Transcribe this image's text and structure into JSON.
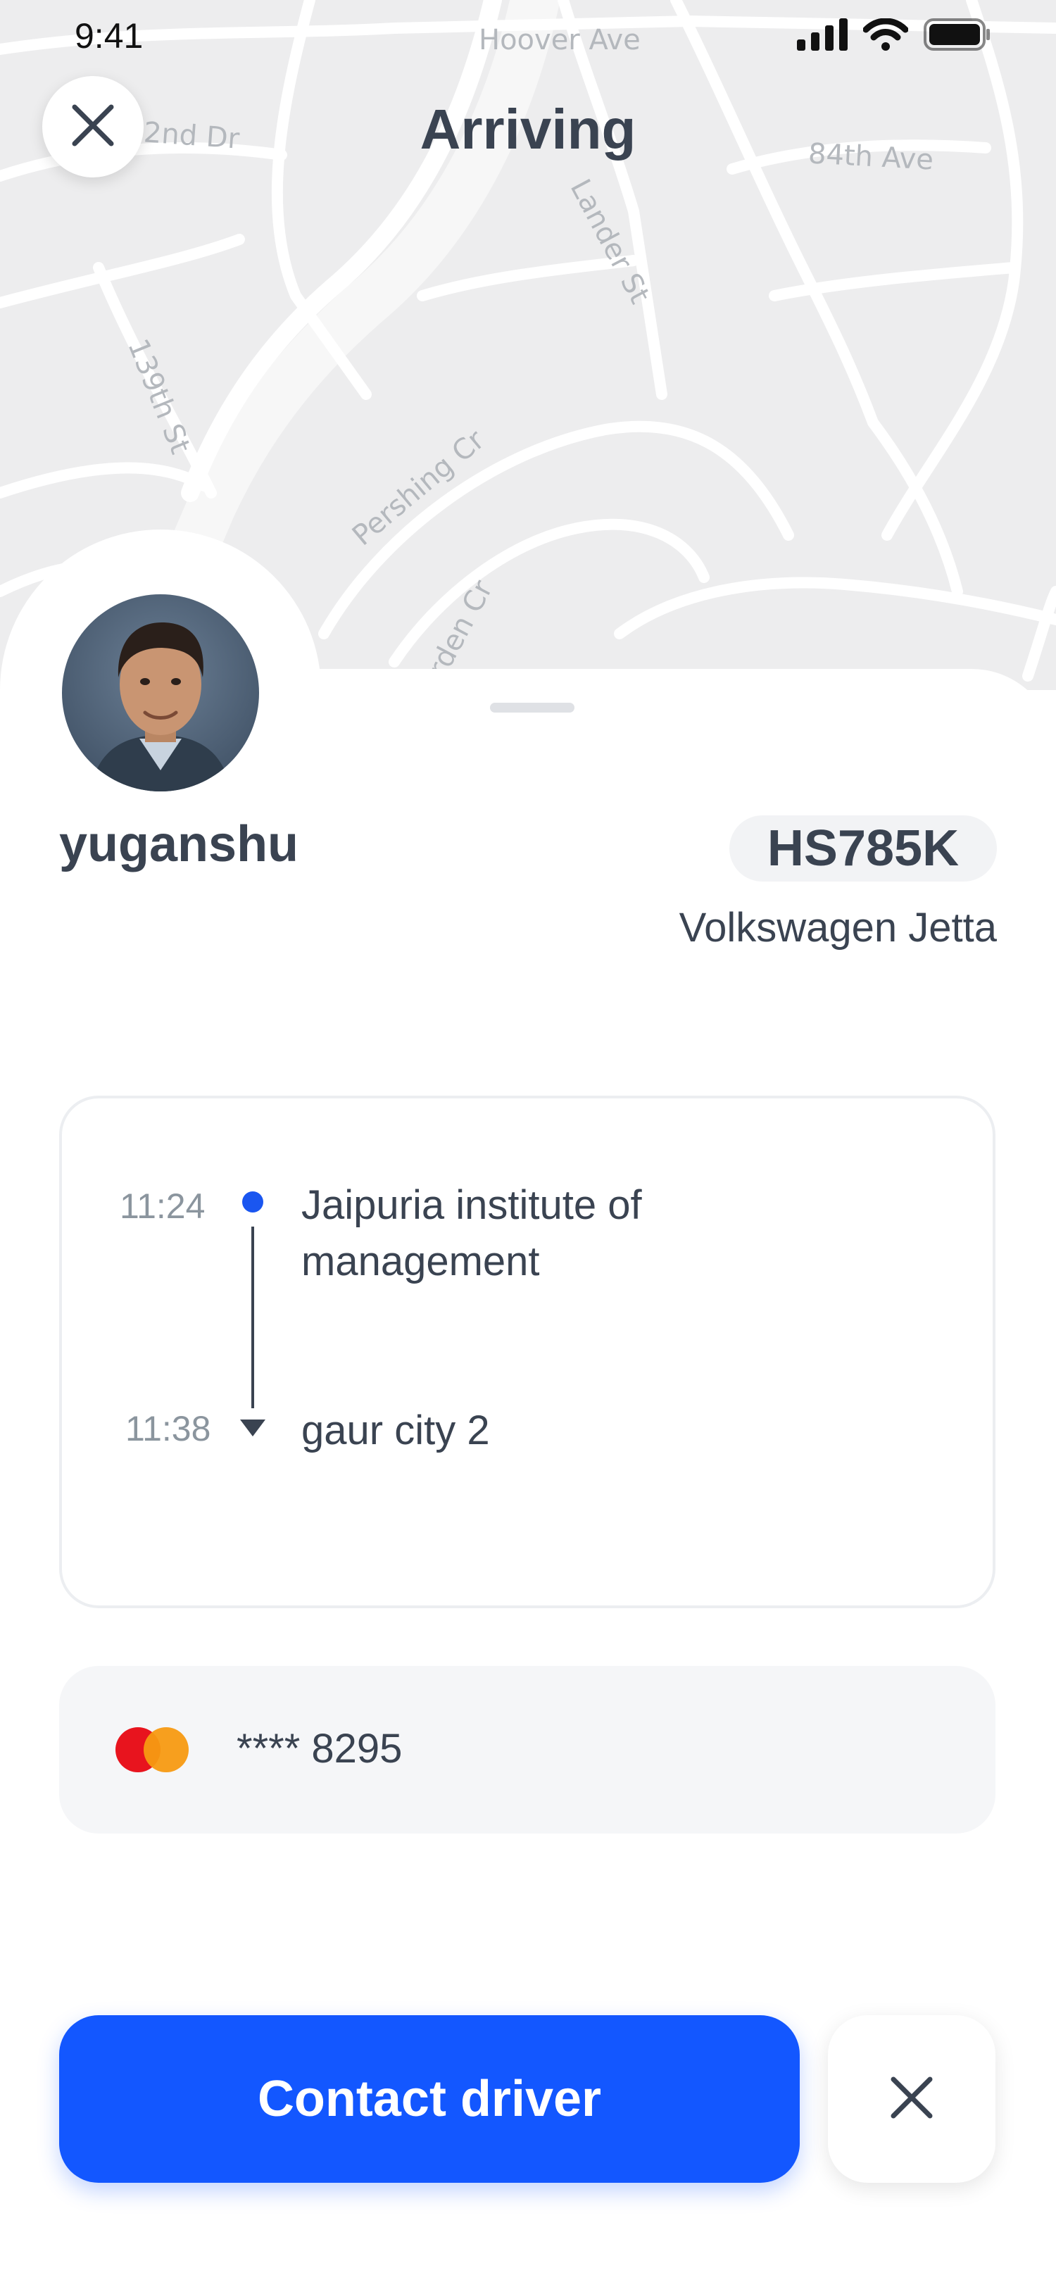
{
  "status_bar": {
    "time": "9:41",
    "signal_icon": "cellular-signal-icon",
    "wifi_icon": "wifi-icon",
    "battery_icon": "battery-icon"
  },
  "map": {
    "street_labels": [
      "Hoover Ave",
      "2nd Dr",
      "84th Ave",
      "Lander St",
      "139th St",
      "Pershing Cr",
      "rden Cr"
    ]
  },
  "header": {
    "title": "Arriving",
    "close_icon": "close-icon"
  },
  "driver": {
    "name": "yuganshu",
    "plate": "HS785K",
    "car_model": "Volkswagen Jetta"
  },
  "route": {
    "stops": [
      {
        "time": "11:24",
        "label": "Jaipuria institute of management"
      },
      {
        "time": "11:38",
        "label": "gaur city 2"
      }
    ],
    "accent_color": "#1A56F0"
  },
  "payment": {
    "card_icon": "mastercard-icon",
    "card_number": "**** 8295"
  },
  "actions": {
    "contact_label": "Contact driver",
    "cancel_icon": "close-icon"
  },
  "colors": {
    "primary": "#1357FF",
    "text": "#3A4351",
    "muted": "#8B959E",
    "map_bg": "#EDEDEE"
  }
}
